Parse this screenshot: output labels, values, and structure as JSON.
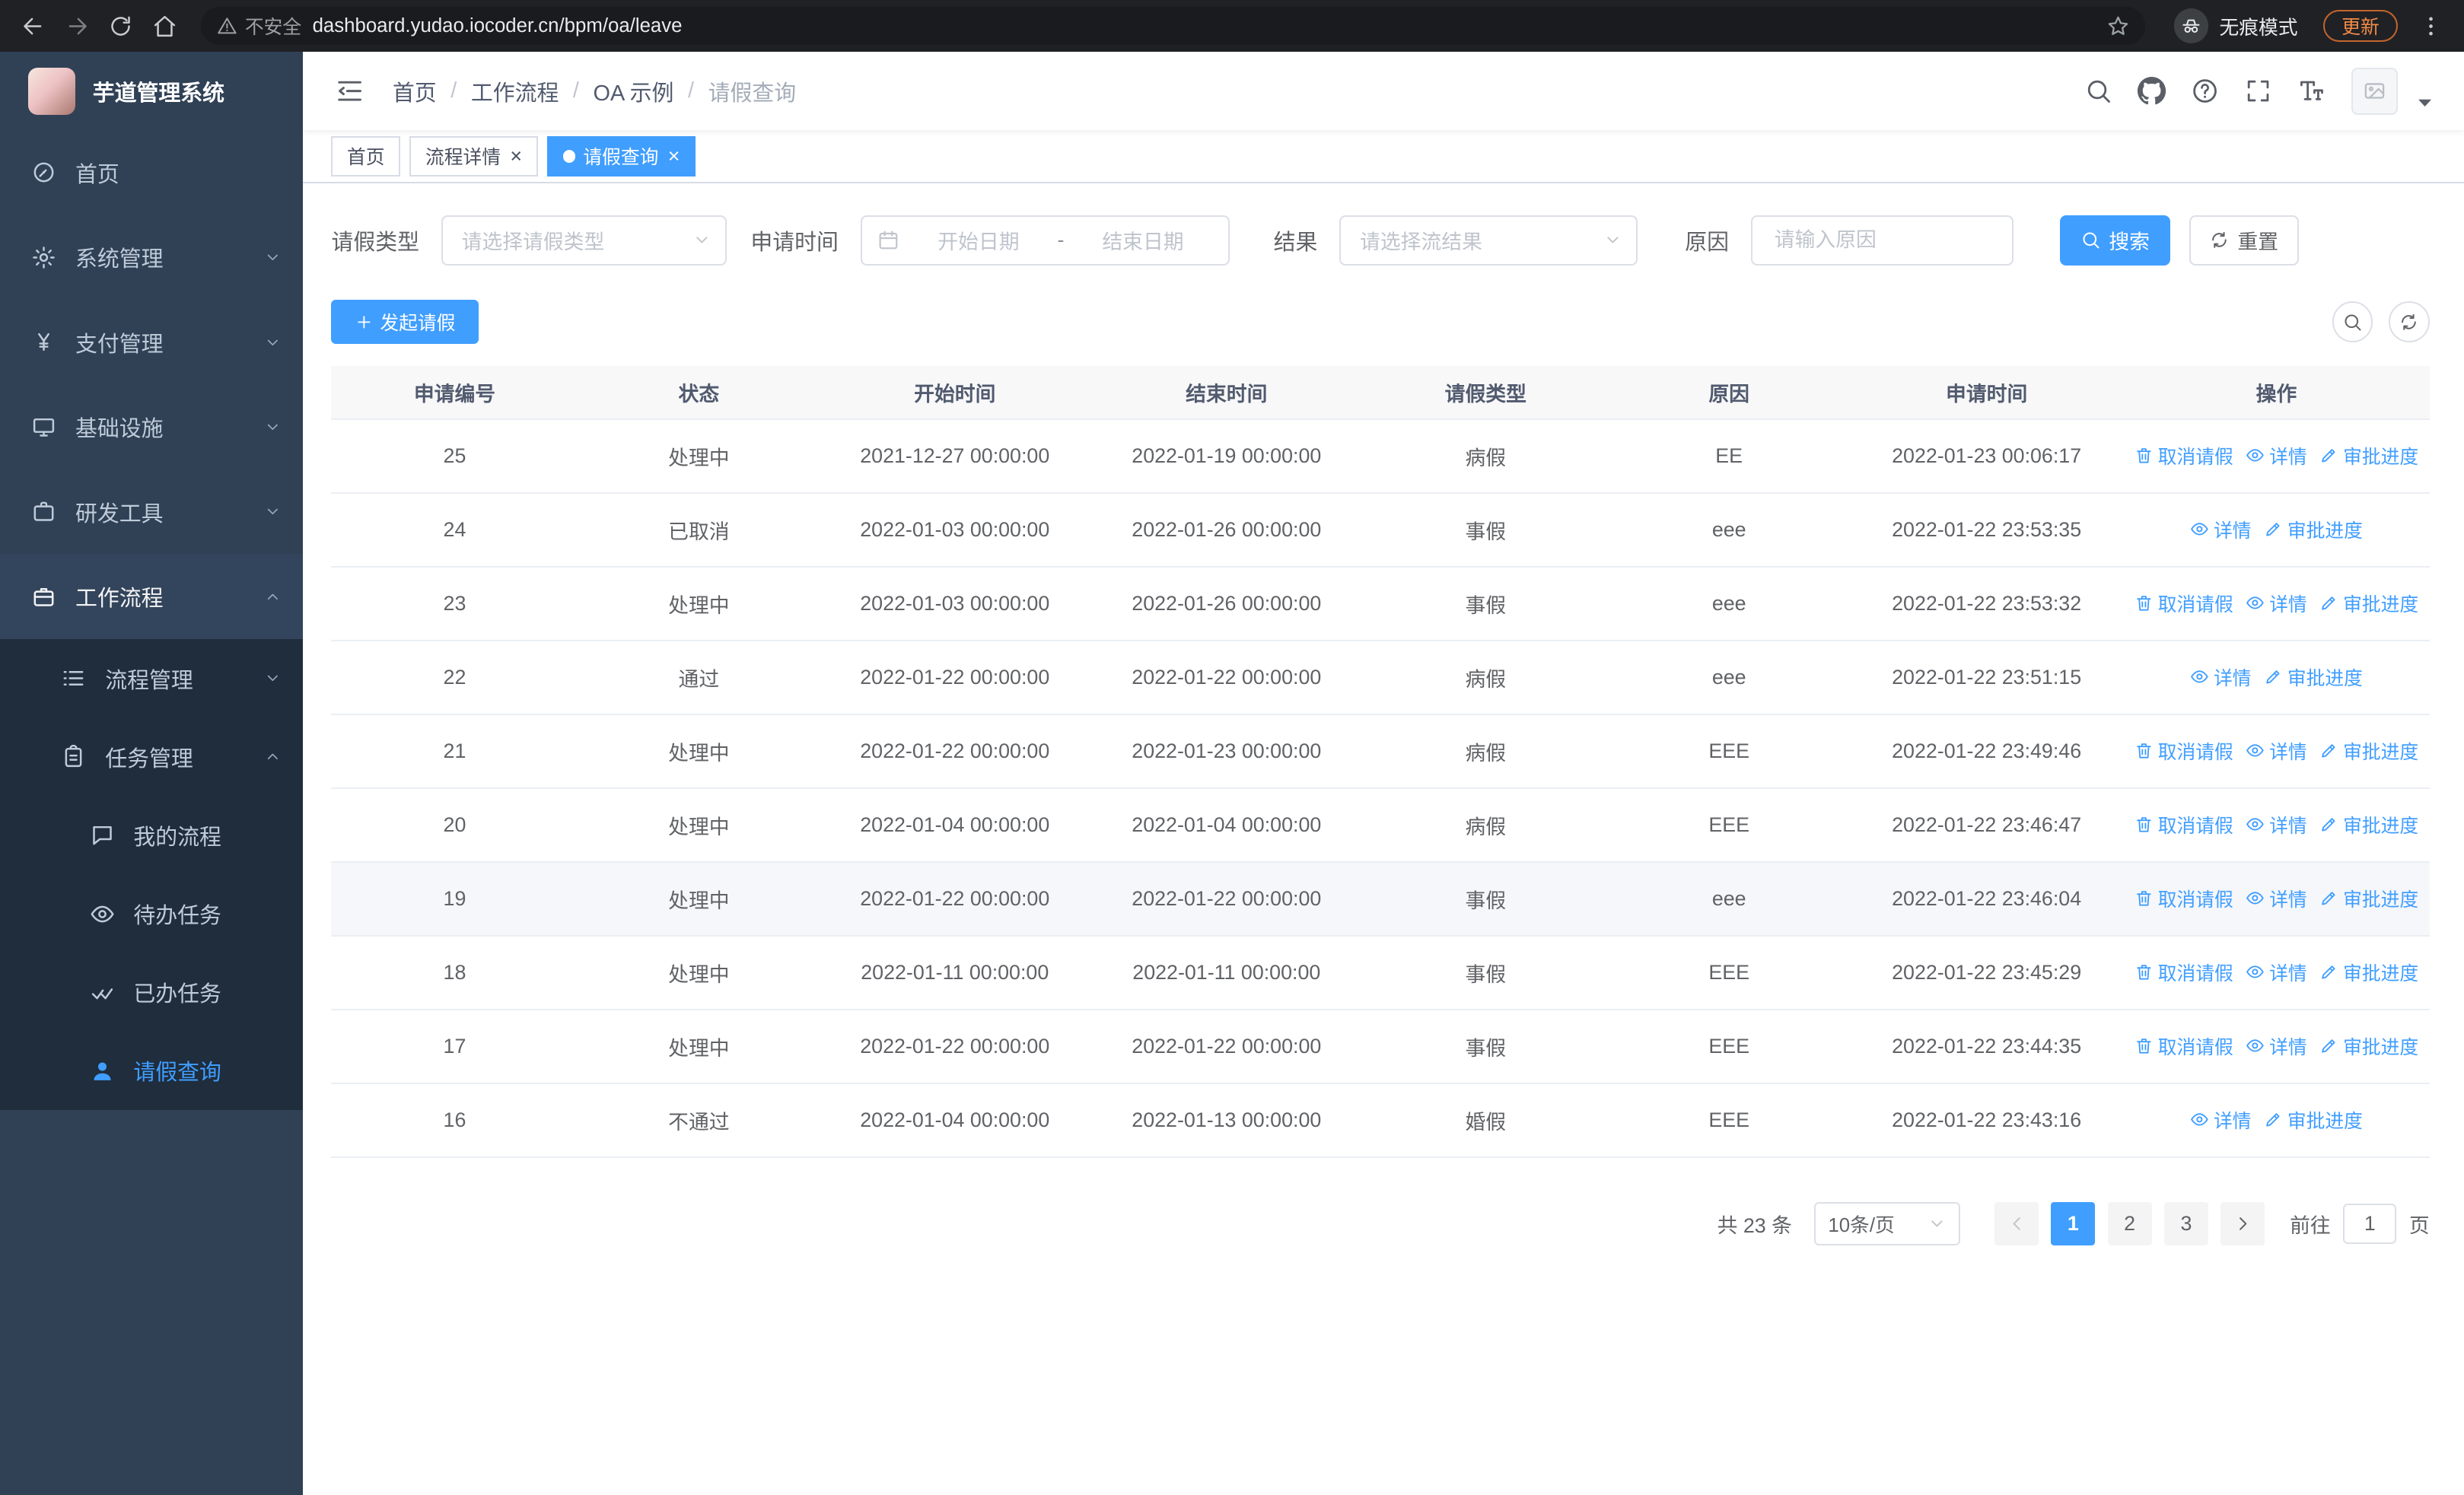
{
  "colors": {
    "primary": "#409eff"
  },
  "browser": {
    "security_label": "不安全",
    "url": "dashboard.yudao.iocoder.cn/bpm/oa/leave",
    "incognito_label": "无痕模式",
    "update_label": "更新"
  },
  "sidebar": {
    "app_title": "芋道管理系统",
    "menu": [
      {
        "key": "home",
        "label": "首页",
        "icon": "dashboard",
        "level": 1
      },
      {
        "key": "system",
        "label": "系统管理",
        "icon": "gear",
        "level": 1,
        "chevron": "down"
      },
      {
        "key": "payment",
        "label": "支付管理",
        "icon": "yen",
        "level": 1,
        "chevron": "down"
      },
      {
        "key": "infrastructure",
        "label": "基础设施",
        "icon": "monitor",
        "level": 1,
        "chevron": "down"
      },
      {
        "key": "devtools",
        "label": "研发工具",
        "icon": "briefcase",
        "level": 1,
        "chevron": "down"
      },
      {
        "key": "workflow",
        "label": "工作流程",
        "icon": "suitcase",
        "level": 1,
        "chevron": "up",
        "open": true
      },
      {
        "key": "process-mgmt",
        "label": "流程管理",
        "icon": "list",
        "level": 2,
        "chevron": "down"
      },
      {
        "key": "task-mgmt",
        "label": "任务管理",
        "icon": "clipboard",
        "level": 2,
        "chevron": "up",
        "open": true
      },
      {
        "key": "my-process",
        "label": "我的流程",
        "icon": "chat",
        "level": 3
      },
      {
        "key": "todo-tasks",
        "label": "待办任务",
        "icon": "eye",
        "level": 3
      },
      {
        "key": "done-tasks",
        "label": "已办任务",
        "icon": "check",
        "level": 3
      },
      {
        "key": "leave-query",
        "label": "请假查询",
        "icon": "user",
        "level": 3,
        "active": true
      }
    ]
  },
  "header": {
    "breadcrumbs": [
      "首页",
      "工作流程",
      "OA 示例",
      "请假查询"
    ]
  },
  "tabs": [
    {
      "key": "home",
      "label": "首页",
      "closable": false,
      "active": false
    },
    {
      "key": "process-detail",
      "label": "流程详情",
      "closable": true,
      "active": false
    },
    {
      "key": "leave-query",
      "label": "请假查询",
      "closable": true,
      "active": true
    }
  ],
  "filters": {
    "leave_type": {
      "label": "请假类型",
      "placeholder": "请选择请假类型"
    },
    "apply_time": {
      "label": "申请时间",
      "start_placeholder": "开始日期",
      "separator": "-",
      "end_placeholder": "结束日期"
    },
    "result": {
      "label": "结果",
      "placeholder": "请选择流结果"
    },
    "reason": {
      "label": "原因",
      "placeholder": "请输入原因"
    },
    "search_label": "搜索",
    "reset_label": "重置"
  },
  "toolbar": {
    "create_label": "发起请假"
  },
  "table": {
    "columns": [
      "申请编号",
      "状态",
      "开始时间",
      "结束时间",
      "请假类型",
      "原因",
      "申请时间",
      "操作"
    ],
    "action_labels": {
      "cancel": "取消请假",
      "detail": "详情",
      "progress": "审批进度"
    },
    "rows": [
      {
        "id": "25",
        "status": "处理中",
        "start": "2021-12-27 00:00:00",
        "end": "2022-01-19 00:00:00",
        "type": "病假",
        "reason": "EE",
        "applied": "2022-01-23 00:06:17",
        "cancelable": true,
        "hover": false
      },
      {
        "id": "24",
        "status": "已取消",
        "start": "2022-01-03 00:00:00",
        "end": "2022-01-26 00:00:00",
        "type": "事假",
        "reason": "eee",
        "applied": "2022-01-22 23:53:35",
        "cancelable": false,
        "hover": false
      },
      {
        "id": "23",
        "status": "处理中",
        "start": "2022-01-03 00:00:00",
        "end": "2022-01-26 00:00:00",
        "type": "事假",
        "reason": "eee",
        "applied": "2022-01-22 23:53:32",
        "cancelable": true,
        "hover": false
      },
      {
        "id": "22",
        "status": "通过",
        "start": "2022-01-22 00:00:00",
        "end": "2022-01-22 00:00:00",
        "type": "病假",
        "reason": "eee",
        "applied": "2022-01-22 23:51:15",
        "cancelable": false,
        "hover": false
      },
      {
        "id": "21",
        "status": "处理中",
        "start": "2022-01-22 00:00:00",
        "end": "2022-01-23 00:00:00",
        "type": "病假",
        "reason": "EEE",
        "applied": "2022-01-22 23:49:46",
        "cancelable": true,
        "hover": false
      },
      {
        "id": "20",
        "status": "处理中",
        "start": "2022-01-04 00:00:00",
        "end": "2022-01-04 00:00:00",
        "type": "病假",
        "reason": "EEE",
        "applied": "2022-01-22 23:46:47",
        "cancelable": true,
        "hover": false
      },
      {
        "id": "19",
        "status": "处理中",
        "start": "2022-01-22 00:00:00",
        "end": "2022-01-22 00:00:00",
        "type": "事假",
        "reason": "eee",
        "applied": "2022-01-22 23:46:04",
        "cancelable": true,
        "hover": true
      },
      {
        "id": "18",
        "status": "处理中",
        "start": "2022-01-11 00:00:00",
        "end": "2022-01-11 00:00:00",
        "type": "事假",
        "reason": "EEE",
        "applied": "2022-01-22 23:45:29",
        "cancelable": true,
        "hover": false
      },
      {
        "id": "17",
        "status": "处理中",
        "start": "2022-01-22 00:00:00",
        "end": "2022-01-22 00:00:00",
        "type": "事假",
        "reason": "EEE",
        "applied": "2022-01-22 23:44:35",
        "cancelable": true,
        "hover": false
      },
      {
        "id": "16",
        "status": "不通过",
        "start": "2022-01-04 00:00:00",
        "end": "2022-01-13 00:00:00",
        "type": "婚假",
        "reason": "EEE",
        "applied": "2022-01-22 23:43:16",
        "cancelable": false,
        "hover": false
      }
    ]
  },
  "pagination": {
    "total": "共 23 条",
    "page_size": "10条/页",
    "pages": [
      "1",
      "2",
      "3"
    ],
    "active_page": "1",
    "goto_label": "前往",
    "goto_value": "1",
    "goto_unit": "页"
  }
}
